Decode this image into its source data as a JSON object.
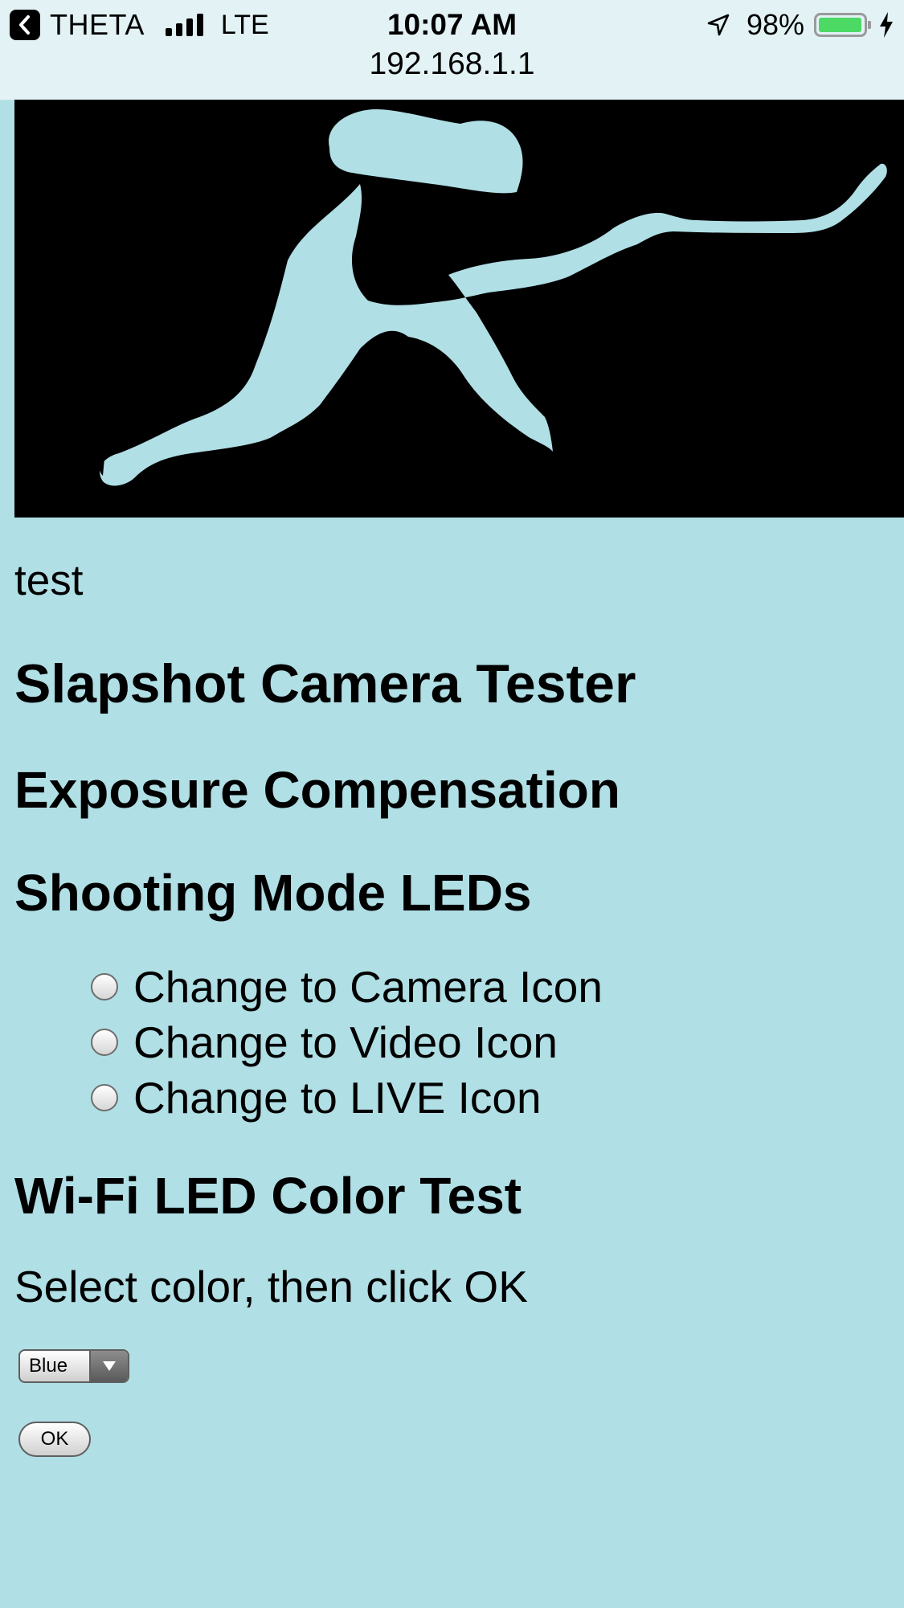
{
  "status_bar": {
    "back_app": "THETA",
    "network": "LTE",
    "time": "10:07 AM",
    "battery_percent": "98%",
    "battery_level": 0.98,
    "url": "192.168.1.1"
  },
  "colors": {
    "page_background": "#b0dfe5",
    "banner_background": "#000000",
    "silhouette": "#b0dfe5",
    "battery": "#4cd964"
  },
  "banner": {
    "icon": "hockey-player-silhouette"
  },
  "content": {
    "intro": "test",
    "title": "Slapshot Camera Tester",
    "exposure_heading": "Exposure Compensation",
    "shooting_heading": "Shooting Mode LEDs",
    "radio_options": [
      {
        "label": "Change to Camera Icon",
        "checked": false
      },
      {
        "label": "Change to Video Icon",
        "checked": false
      },
      {
        "label": "Change to LIVE Icon",
        "checked": false
      }
    ],
    "wifi_heading": "Wi-Fi LED Color Test",
    "wifi_instruction": "Select color, then click OK",
    "color_select_value": "Blue",
    "ok_label": "OK"
  }
}
